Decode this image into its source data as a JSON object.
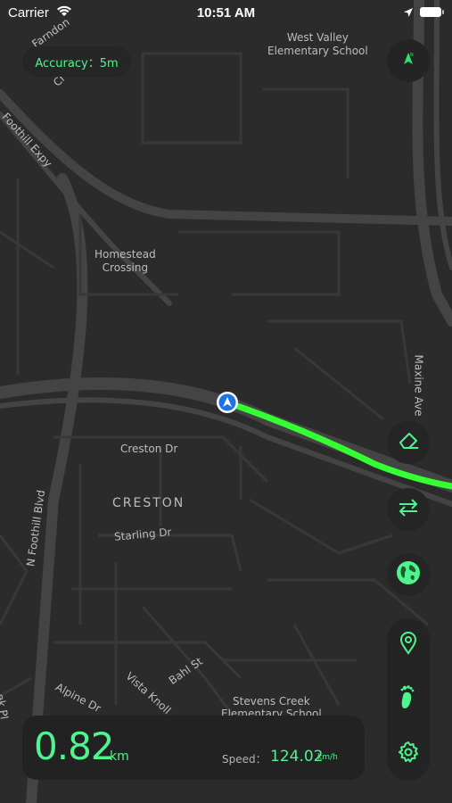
{
  "status_bar": {
    "carrier": "Carrier",
    "time": "10:51 AM"
  },
  "accuracy": {
    "label": "Accuracy：5m"
  },
  "map_labels": {
    "school_1": "West Valley\nElementary School",
    "homestead": "Homestead\nCrossing",
    "creston_dr": "Creston Dr",
    "creston": "CRESTON",
    "starling_dr": "Starling Dr",
    "n_foothill_blvd": "N Foothill Blvd",
    "maxine_ave": "Maxine Ave",
    "foothill_expy": "Foothill Expy",
    "farndon": "Farndon",
    "cr": "Cr",
    "bahl_st": "Bahl St",
    "vista_knoll": "Vista Knoll",
    "alpine_dr": "Alpine Dr",
    "stevens_creek": "Stevens Creek\nElementary School",
    "pt": "ek Pl"
  },
  "stats": {
    "distance": "0.82",
    "distance_unit": "km",
    "speed_label": "Speed：",
    "speed_value": "124.02",
    "speed_unit": "km/h"
  },
  "buttons": {
    "compass": "compass-icon",
    "eraser": "eraser-icon",
    "swap": "swap-arrows-icon",
    "globe": "globe-icon",
    "pin": "location-pin-icon",
    "footprint": "footprint-icon",
    "settings": "gear-icon"
  },
  "colors": {
    "accent": "#4ef58e",
    "track": "#33ff33",
    "map_bg": "#2b2b2b",
    "road": "#3d3d3d"
  }
}
